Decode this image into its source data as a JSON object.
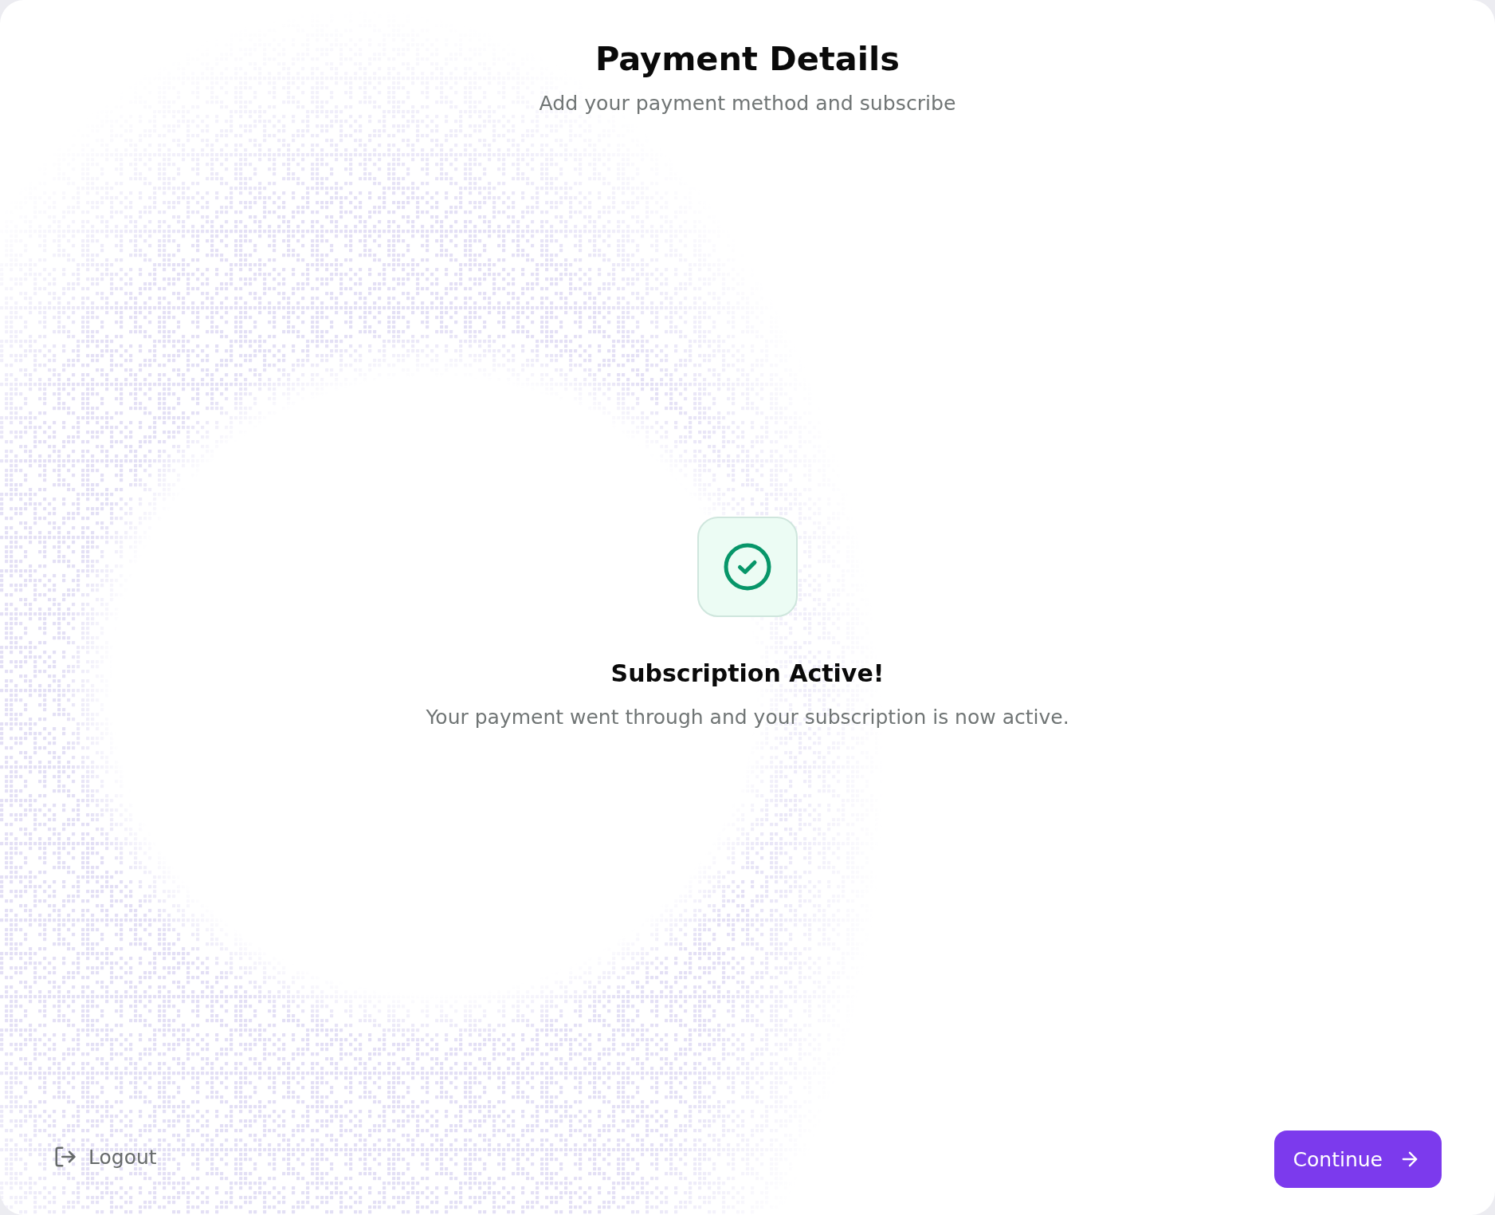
{
  "header": {
    "title": "Payment Details",
    "subtitle": "Add your payment method and subscribe"
  },
  "status": {
    "title": "Subscription Active!",
    "message": "Your payment went through and your subscription is now active."
  },
  "footer": {
    "logout_button": {
      "label": "Logout"
    },
    "continue_button": {
      "label": "Continue"
    }
  }
}
